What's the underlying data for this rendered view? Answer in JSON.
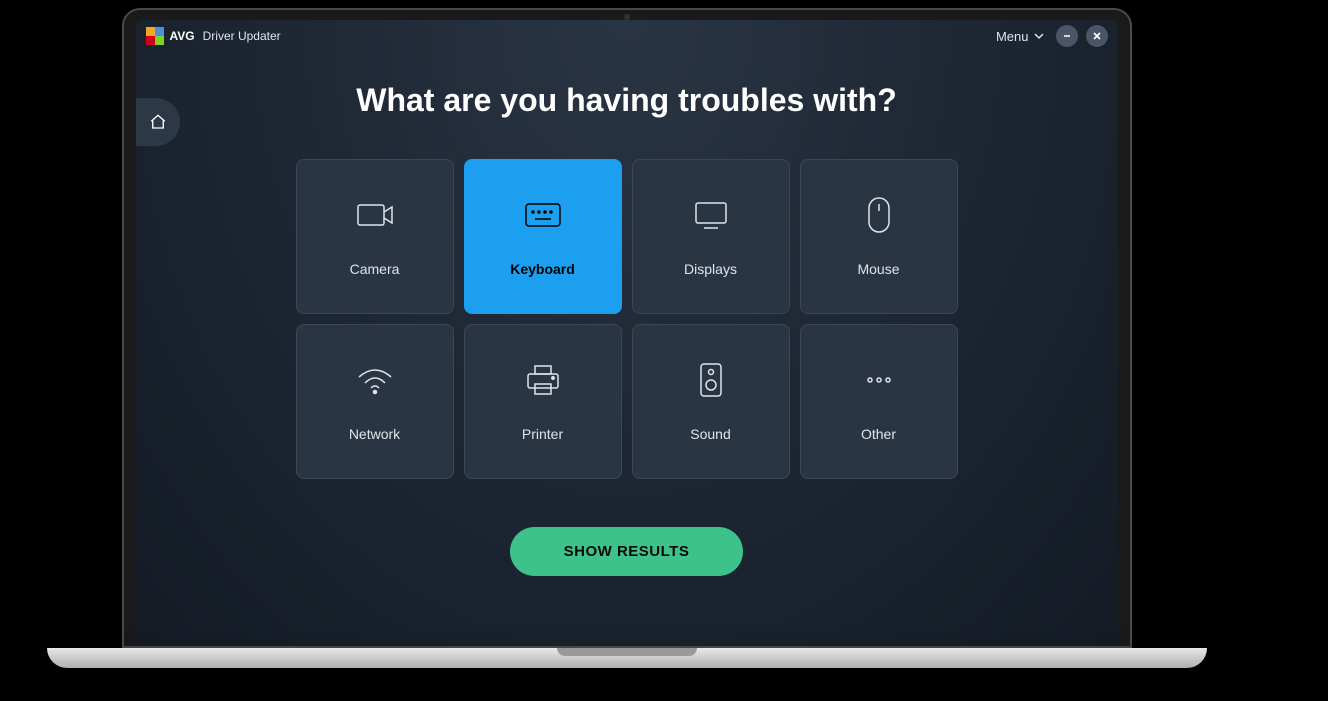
{
  "app": {
    "brand": "AVG",
    "product": "Driver Updater",
    "menu_label": "Menu"
  },
  "main": {
    "heading": "What are you having troubles with?",
    "show_results_label": "SHOW RESULTS"
  },
  "tiles": [
    {
      "id": "camera",
      "label": "Camera",
      "icon": "camera-icon",
      "selected": false
    },
    {
      "id": "keyboard",
      "label": "Keyboard",
      "icon": "keyboard-icon",
      "selected": true
    },
    {
      "id": "displays",
      "label": "Displays",
      "icon": "display-icon",
      "selected": false
    },
    {
      "id": "mouse",
      "label": "Mouse",
      "icon": "mouse-icon",
      "selected": false
    },
    {
      "id": "network",
      "label": "Network",
      "icon": "wifi-icon",
      "selected": false
    },
    {
      "id": "printer",
      "label": "Printer",
      "icon": "printer-icon",
      "selected": false
    },
    {
      "id": "sound",
      "label": "Sound",
      "icon": "speaker-icon",
      "selected": false
    },
    {
      "id": "other",
      "label": "Other",
      "icon": "more-icon",
      "selected": false
    }
  ],
  "colors": {
    "accent": "#1d9ff0",
    "cta": "#3cc28a",
    "bg_tile": "#2a3544"
  }
}
